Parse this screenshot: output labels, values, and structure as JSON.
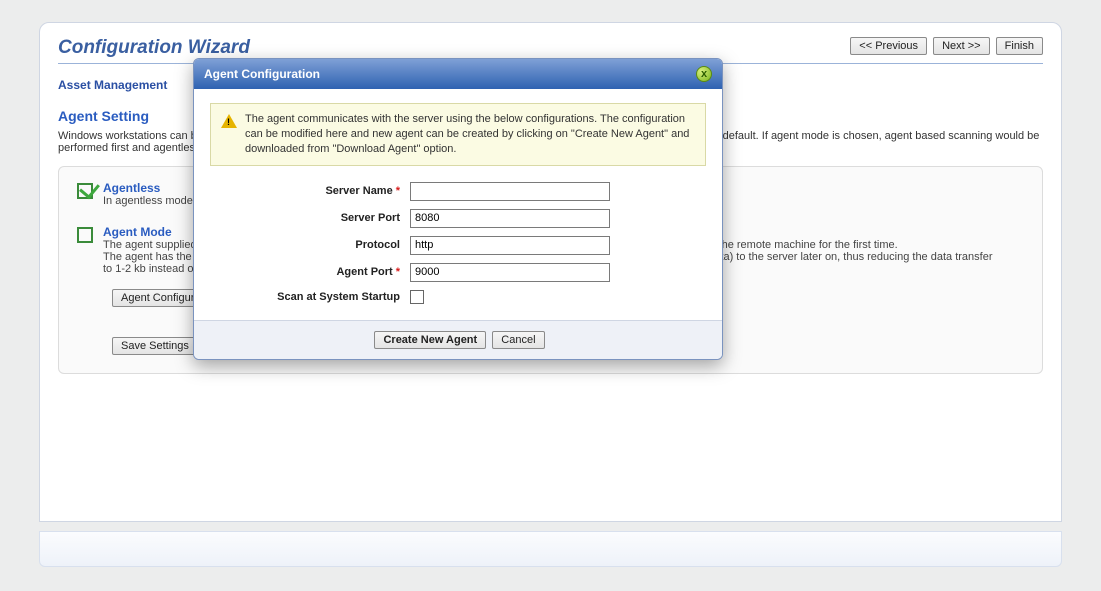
{
  "wizard": {
    "title": "Configuration Wizard",
    "prev": "<< Previous",
    "next": "Next >>",
    "finish": "Finish"
  },
  "section": {
    "asset_mgmt": "Asset Management"
  },
  "agent_setting": {
    "title": "Agent Setting",
    "description": "Windows workstations can be scanned either using scripts executed on remote machines or using agents. Agentless mode is chosen by default. If agent mode is chosen, agent based scanning would be performed first and agentless scan is tried only in case of failure."
  },
  "modes": {
    "agentless": {
      "title": "Agentless",
      "desc": "In agentless mode, scripts are executed on remote machines to fetch the required data."
    },
    "agent": {
      "title": "Agent Mode",
      "desc_line1": "The agent supplied should be installed in the workstations. This agent fetches the complete workstation details while scanning the remote machine for the first time.",
      "desc_line2": "The agent has the intelligence to capture only the changes in workstation details and sends only this information (differential data) to the server later on, thus reducing the data transfer",
      "desc_line3": "to 1-2 kb instead of about 40 kb."
    }
  },
  "underpanel": {
    "agent_config_btn": "Agent Configuration",
    "save": "Save Settings"
  },
  "dialog": {
    "title": "Agent Configuration",
    "info": "The agent communicates with the server using the below configurations. The configuration can be modified here and new agent can be created by clicking on \"Create New Agent\" and downloaded from \"Download Agent\" option.",
    "fields": {
      "server_name": {
        "label": "Server Name",
        "value": "",
        "required": true
      },
      "server_port": {
        "label": "Server Port",
        "value": "8080",
        "required": false
      },
      "protocol": {
        "label": "Protocol",
        "value": "http",
        "required": false
      },
      "agent_port": {
        "label": "Agent Port",
        "value": "9000",
        "required": true
      },
      "scan_startup": {
        "label": "Scan at System Startup",
        "checked": false
      }
    },
    "create_btn": "Create New Agent",
    "cancel_btn": "Cancel"
  }
}
